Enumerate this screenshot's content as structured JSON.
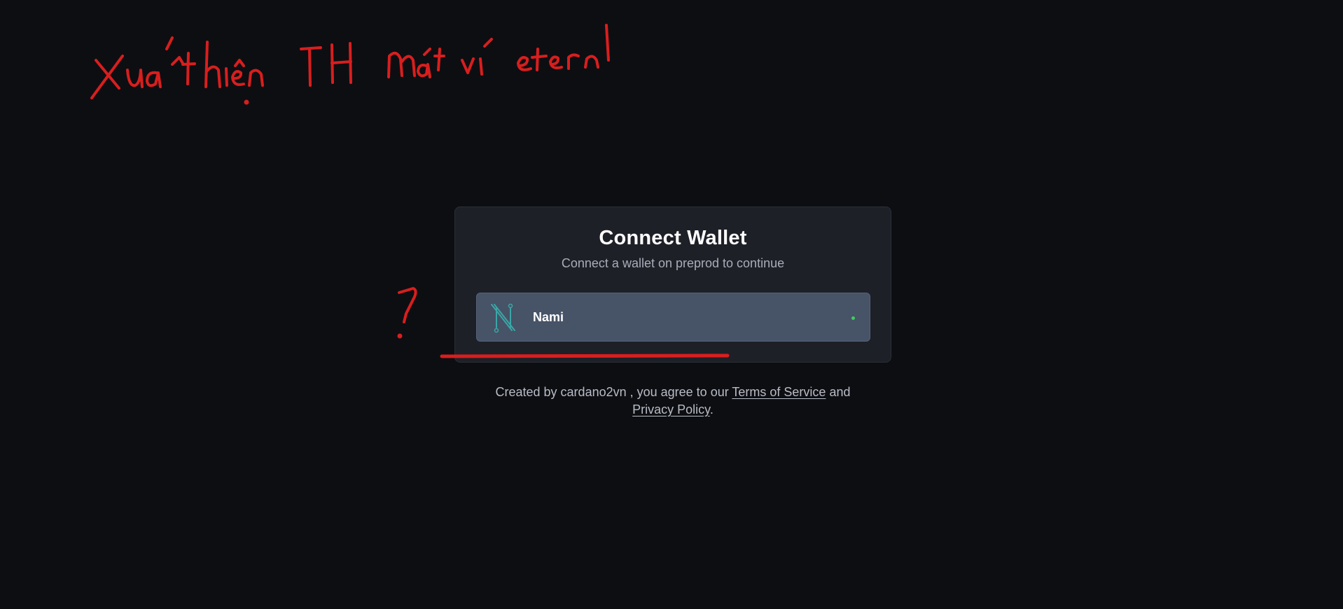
{
  "modal": {
    "title": "Connect Wallet",
    "subtitle": "Connect a wallet on preprod to continue"
  },
  "wallets": [
    {
      "name": "Nami",
      "icon": "nami-logo-icon",
      "status": "available",
      "status_color": "#3ecf5a"
    }
  ],
  "footer": {
    "prefix": "Created by cardano2vn , you agree to our ",
    "terms_label": "Terms of Service",
    "middle": " and",
    "privacy_label": "Privacy Policy",
    "suffix": "."
  },
  "annotations": {
    "handwritten_note": "Xuất hiện TH mất ví eternl",
    "question_mark": "?",
    "color": "#d91e1e"
  },
  "colors": {
    "background": "#0d0e12",
    "card": "#1e2028",
    "wallet_button": "#475367",
    "accent_logo": "#3aa6a6"
  }
}
